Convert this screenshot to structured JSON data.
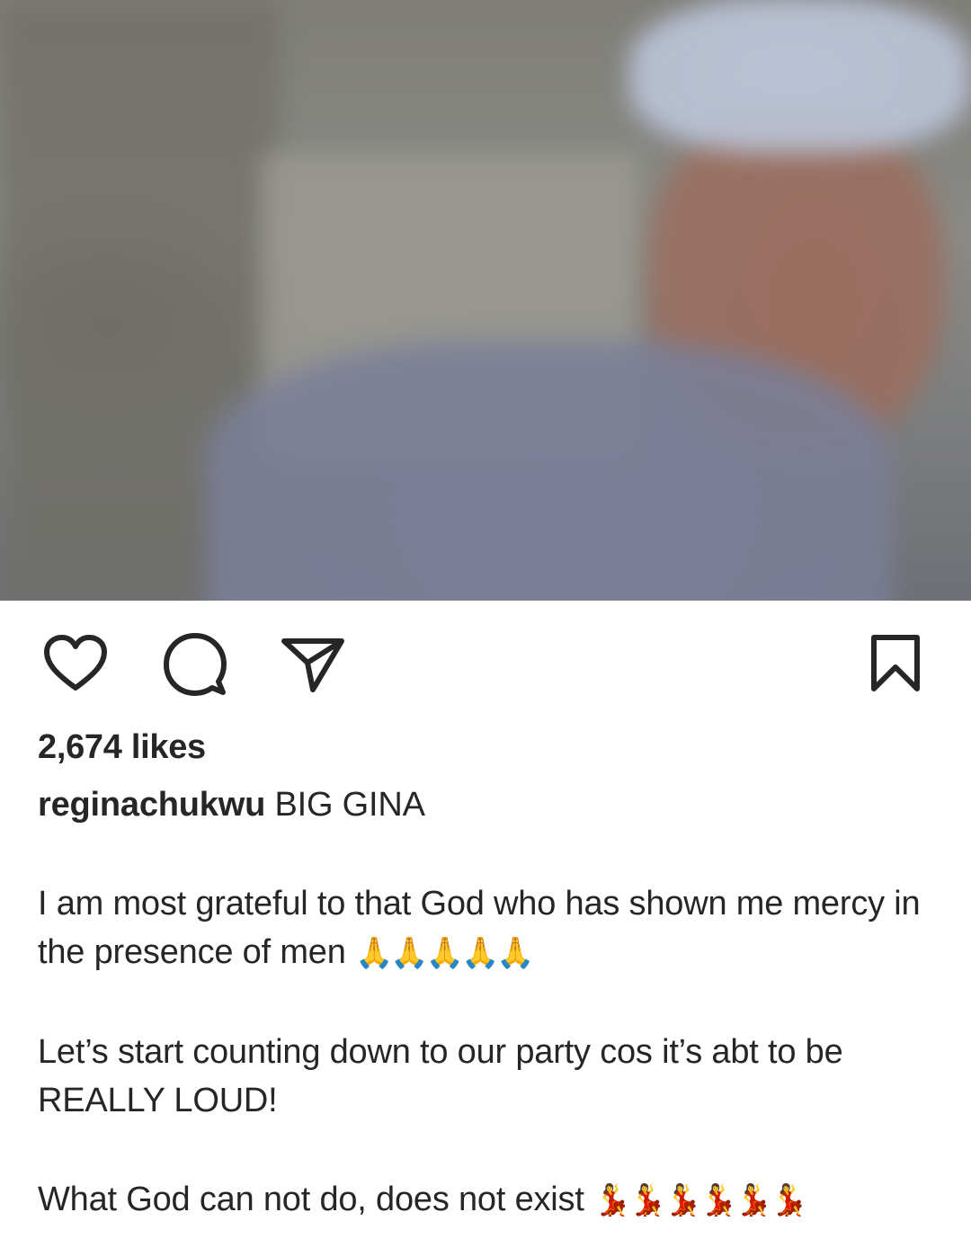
{
  "post": {
    "likes_text": "2,674 likes",
    "username": "reginachukwu",
    "caption_title": "BIG GINA",
    "paragraph1": "I am most grateful to that God who has shown me mercy in the presence of men",
    "paragraph1_emoji": "🙏🙏🙏🙏🙏",
    "paragraph2": "Let’s start counting down to our party cos it’s abt to be REALLY LOUD!",
    "paragraph3": "What God can not do, does not exist",
    "paragraph3_emoji": "💃💃💃💃💃💃"
  },
  "icons": {
    "like": "heart-icon",
    "comment": "comment-bubble-icon",
    "share": "paper-plane-icon",
    "save": "bookmark-icon"
  }
}
